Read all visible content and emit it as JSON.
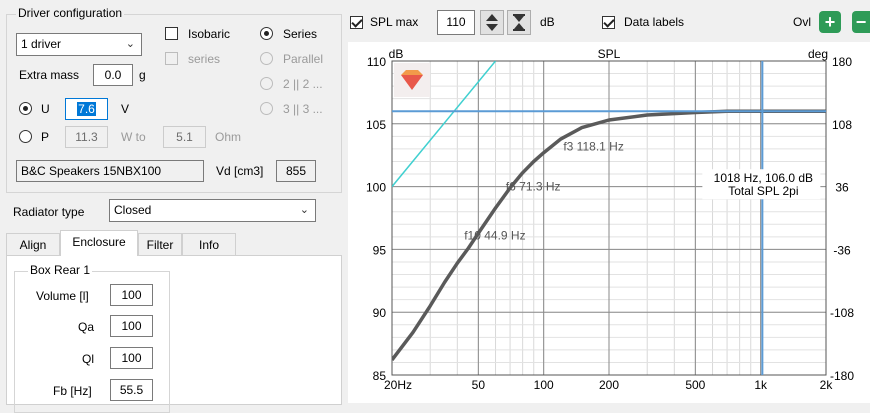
{
  "driver_config": {
    "title": "Driver configuration",
    "driver_count": "1 driver",
    "isobaric_label": "Isobaric",
    "isobaric_checked": false,
    "series_check_label": "series",
    "radio_series": "Series",
    "radio_parallel": "Parallel",
    "radio_2x2": "2 || 2 ...",
    "radio_3x3": "3 || 3 ...",
    "extra_mass_label": "Extra mass",
    "extra_mass_value": "0.0",
    "extra_mass_unit": "g",
    "u_label": "U",
    "u_value": "7.6",
    "u_unit": "V",
    "p_label": "P",
    "p_value": "11.3",
    "w_to_label": "W to",
    "ohm_value": "5.1",
    "ohm_unit": "Ohm",
    "driver_name": "B&C Speakers 15NBX100",
    "vd_label": "Vd [cm3]",
    "vd_value": "855"
  },
  "radiator": {
    "label": "Radiator type",
    "value": "Closed"
  },
  "tabs": [
    {
      "label": "Align"
    },
    {
      "label": "Enclosure"
    },
    {
      "label": "Filter"
    },
    {
      "label": "Info"
    }
  ],
  "box_rear": {
    "title": "Box Rear 1",
    "volume_label": "Volume [l]",
    "volume_value": "100",
    "qa_label": "Qa",
    "qa_value": "100",
    "ql_label": "Ql",
    "ql_value": "100",
    "fb_label": "Fb [Hz]",
    "fb_value": "55.5"
  },
  "toolbar": {
    "spl_max_label": "SPL max",
    "spl_max_checked": true,
    "spl_max_value": "110",
    "db_unit": "dB",
    "data_labels_label": "Data labels",
    "data_labels_checked": true,
    "ovl_label": "Ovl",
    "add_icon": "plus-icon",
    "remove_icon": "minus-icon"
  },
  "chart_data": {
    "type": "line",
    "title": "SPL",
    "ylabel": "dB",
    "y2label": "deg",
    "xscale": "log",
    "xlim": [
      20,
      2000
    ],
    "ylim": [
      85,
      110
    ],
    "y2lim": [
      -180,
      180
    ],
    "xticks": [
      "20Hz",
      "50",
      "100",
      "200",
      "500",
      "1k",
      "2k"
    ],
    "xtick_values": [
      20,
      50,
      100,
      200,
      500,
      1000,
      2000
    ],
    "yticks": [
      "85",
      "90",
      "95",
      "100",
      "105",
      "110"
    ],
    "y2ticks": [
      "-180",
      "-108",
      "-36",
      "36",
      "108",
      "180"
    ],
    "grid": true,
    "series": [
      {
        "name": "Total SPL 2pi",
        "color": "#5a5a5a",
        "x": [
          20,
          25,
          30,
          35,
          40,
          45,
          50,
          60,
          70,
          80,
          90,
          100,
          120,
          150,
          200,
          300,
          500,
          700,
          1000,
          1500,
          2000
        ],
        "y": [
          86.2,
          88.4,
          90.5,
          92.4,
          93.9,
          95.1,
          96.3,
          98.3,
          99.9,
          101.1,
          102.0,
          102.7,
          103.8,
          104.7,
          105.3,
          105.7,
          105.9,
          106.0,
          106.0,
          106.0,
          106.0
        ]
      },
      {
        "name": "",
        "color": "#40d0d0",
        "x": [
          20,
          60
        ],
        "y": [
          100.0,
          110.0
        ]
      }
    ],
    "annotations": [
      {
        "text": "f3 118.1 Hz",
        "x": 118.1,
        "y": 103.2
      },
      {
        "text": "f6 71.3 Hz",
        "x": 71.3,
        "y": 100.0
      },
      {
        "text": "f10 44.9 Hz",
        "x": 44.9,
        "y": 96.1
      },
      {
        "text": "1018 Hz, 106.0 dB",
        "x": 1018,
        "y": 106.0
      },
      {
        "text": "Total SPL 2pi",
        "x": 1018,
        "y": 106.0
      }
    ],
    "cursor": {
      "x": 1018,
      "y": 106.0,
      "color": "#5b9bd5"
    },
    "marker_icon": "shield-logo-icon"
  }
}
